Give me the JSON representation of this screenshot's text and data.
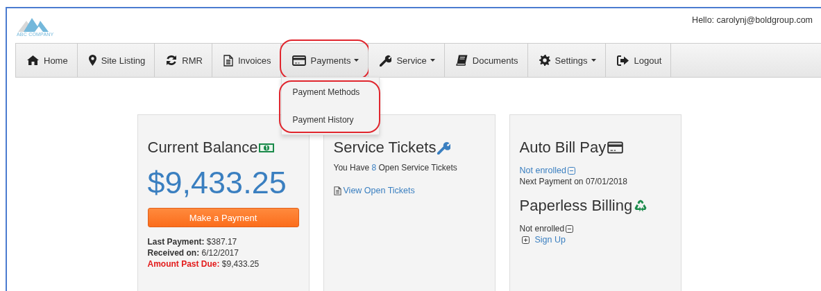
{
  "logo": {
    "text": "ABC COMPANY"
  },
  "greeting": "Hello: carolynj@boldgroup.com",
  "nav": [
    {
      "label": "Home",
      "kind": "home",
      "caret": false,
      "annotated": false,
      "open": false
    },
    {
      "label": "Site Listing",
      "kind": "pin",
      "caret": false,
      "annotated": false,
      "open": false
    },
    {
      "label": "RMR",
      "kind": "refresh",
      "caret": false,
      "annotated": false,
      "open": false
    },
    {
      "label": "Invoices",
      "kind": "document",
      "caret": false,
      "annotated": false,
      "open": false
    },
    {
      "label": "Payments",
      "kind": "card",
      "caret": true,
      "annotated": true,
      "open": true
    },
    {
      "label": "Service",
      "kind": "wrench",
      "caret": true,
      "annotated": false,
      "open": false
    },
    {
      "label": "Documents",
      "kind": "book",
      "caret": false,
      "annotated": false,
      "open": false
    },
    {
      "label": "Settings",
      "kind": "gear",
      "caret": true,
      "annotated": false,
      "open": false
    },
    {
      "label": "Logout",
      "kind": "logout",
      "caret": false,
      "annotated": false,
      "open": false
    }
  ],
  "dropdown": {
    "annotated": true,
    "items": [
      "Payment Methods",
      "Payment History"
    ]
  },
  "balance_card": {
    "title": "Current Balance",
    "amount": "$9,433.25",
    "button": "Make a Payment",
    "details": [
      {
        "label": "Last Payment:",
        "value": "$387.17",
        "kind": "normal"
      },
      {
        "label": "Received on:",
        "value": "6/12/2017",
        "kind": "normal"
      },
      {
        "label": "Amount Past Due:",
        "value": "$9,433.25",
        "kind": "alert"
      }
    ]
  },
  "tickets_card": {
    "title": "Service Tickets",
    "before": "You Have ",
    "count": "8",
    "after": " Open Service Tickets",
    "link": "View Open Tickets"
  },
  "billing_card": {
    "title": "Auto Bill Pay",
    "status": "Not enrolled",
    "next_payment": "Next Payment on 07/01/2018",
    "paperless_title": "Paperless Billing",
    "paperless_status": "Not enrolled",
    "signup": "Sign Up"
  }
}
